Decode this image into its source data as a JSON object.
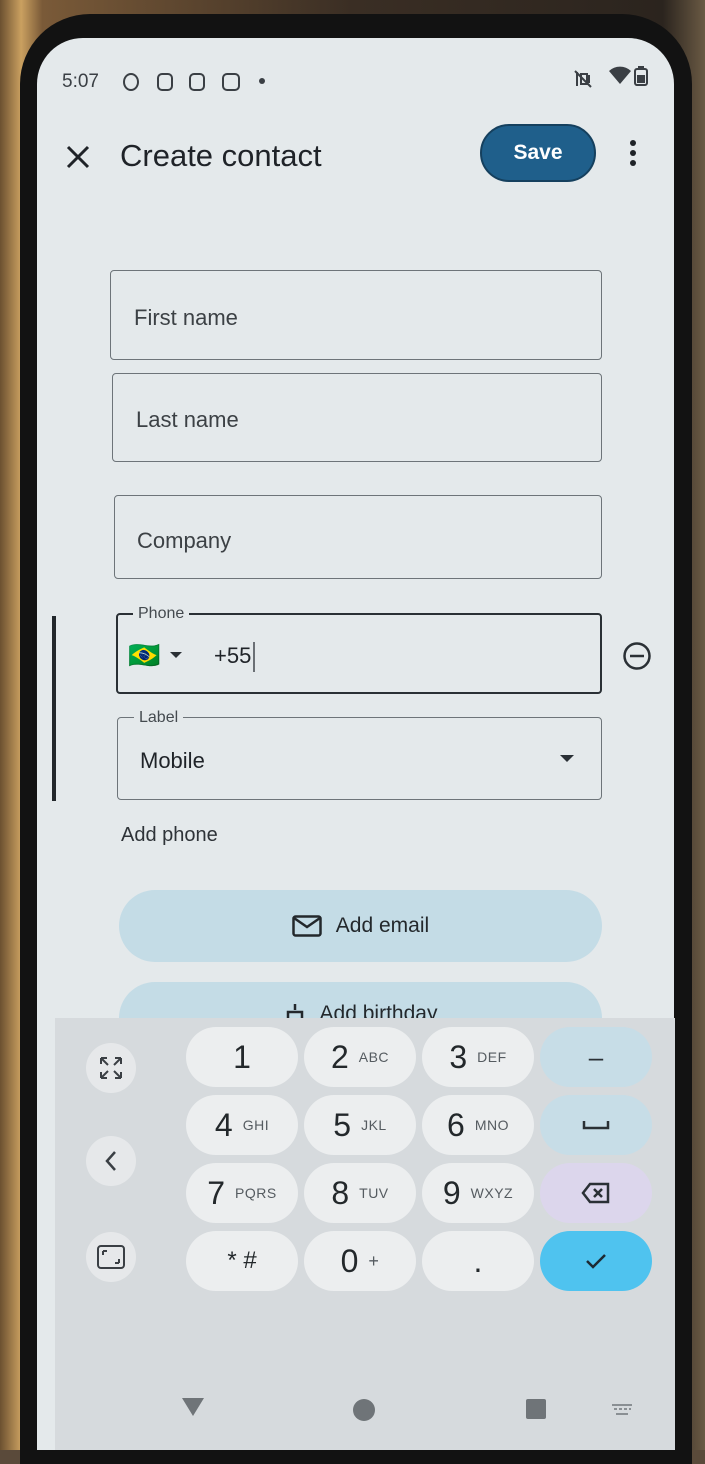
{
  "status_bar": {
    "time": "5:07"
  },
  "header": {
    "title": "Create contact",
    "save_label": "Save"
  },
  "form": {
    "first_name_placeholder": "First name",
    "last_name_placeholder": "Last name",
    "company_placeholder": "Company",
    "phone_label": "Phone",
    "phone_value": "+55",
    "country_flag": "🇧🇷",
    "type_label": "Label",
    "type_value": "Mobile",
    "add_phone": "Add phone",
    "add_email": "Add email",
    "add_birthday": "Add birthday"
  },
  "keypad": {
    "keys": [
      {
        "digit": "1",
        "letters": ""
      },
      {
        "digit": "2",
        "letters": "ABC"
      },
      {
        "digit": "3",
        "letters": "DEF"
      },
      {
        "digit": "4",
        "letters": "GHI"
      },
      {
        "digit": "5",
        "letters": "JKL"
      },
      {
        "digit": "6",
        "letters": "MNO"
      },
      {
        "digit": "7",
        "letters": "PQRS"
      },
      {
        "digit": "8",
        "letters": "TUV"
      },
      {
        "digit": "9",
        "letters": "WXYZ"
      },
      {
        "digit": "* #",
        "letters": ""
      },
      {
        "digit": "0",
        "letters": "+"
      },
      {
        "digit": ".",
        "letters": ""
      }
    ],
    "dash": "–"
  },
  "colors": {
    "save": "#1f5f8b",
    "pill": "#c4dce6",
    "done": "#4fc3ef",
    "backspace": "#dcd6ec"
  }
}
